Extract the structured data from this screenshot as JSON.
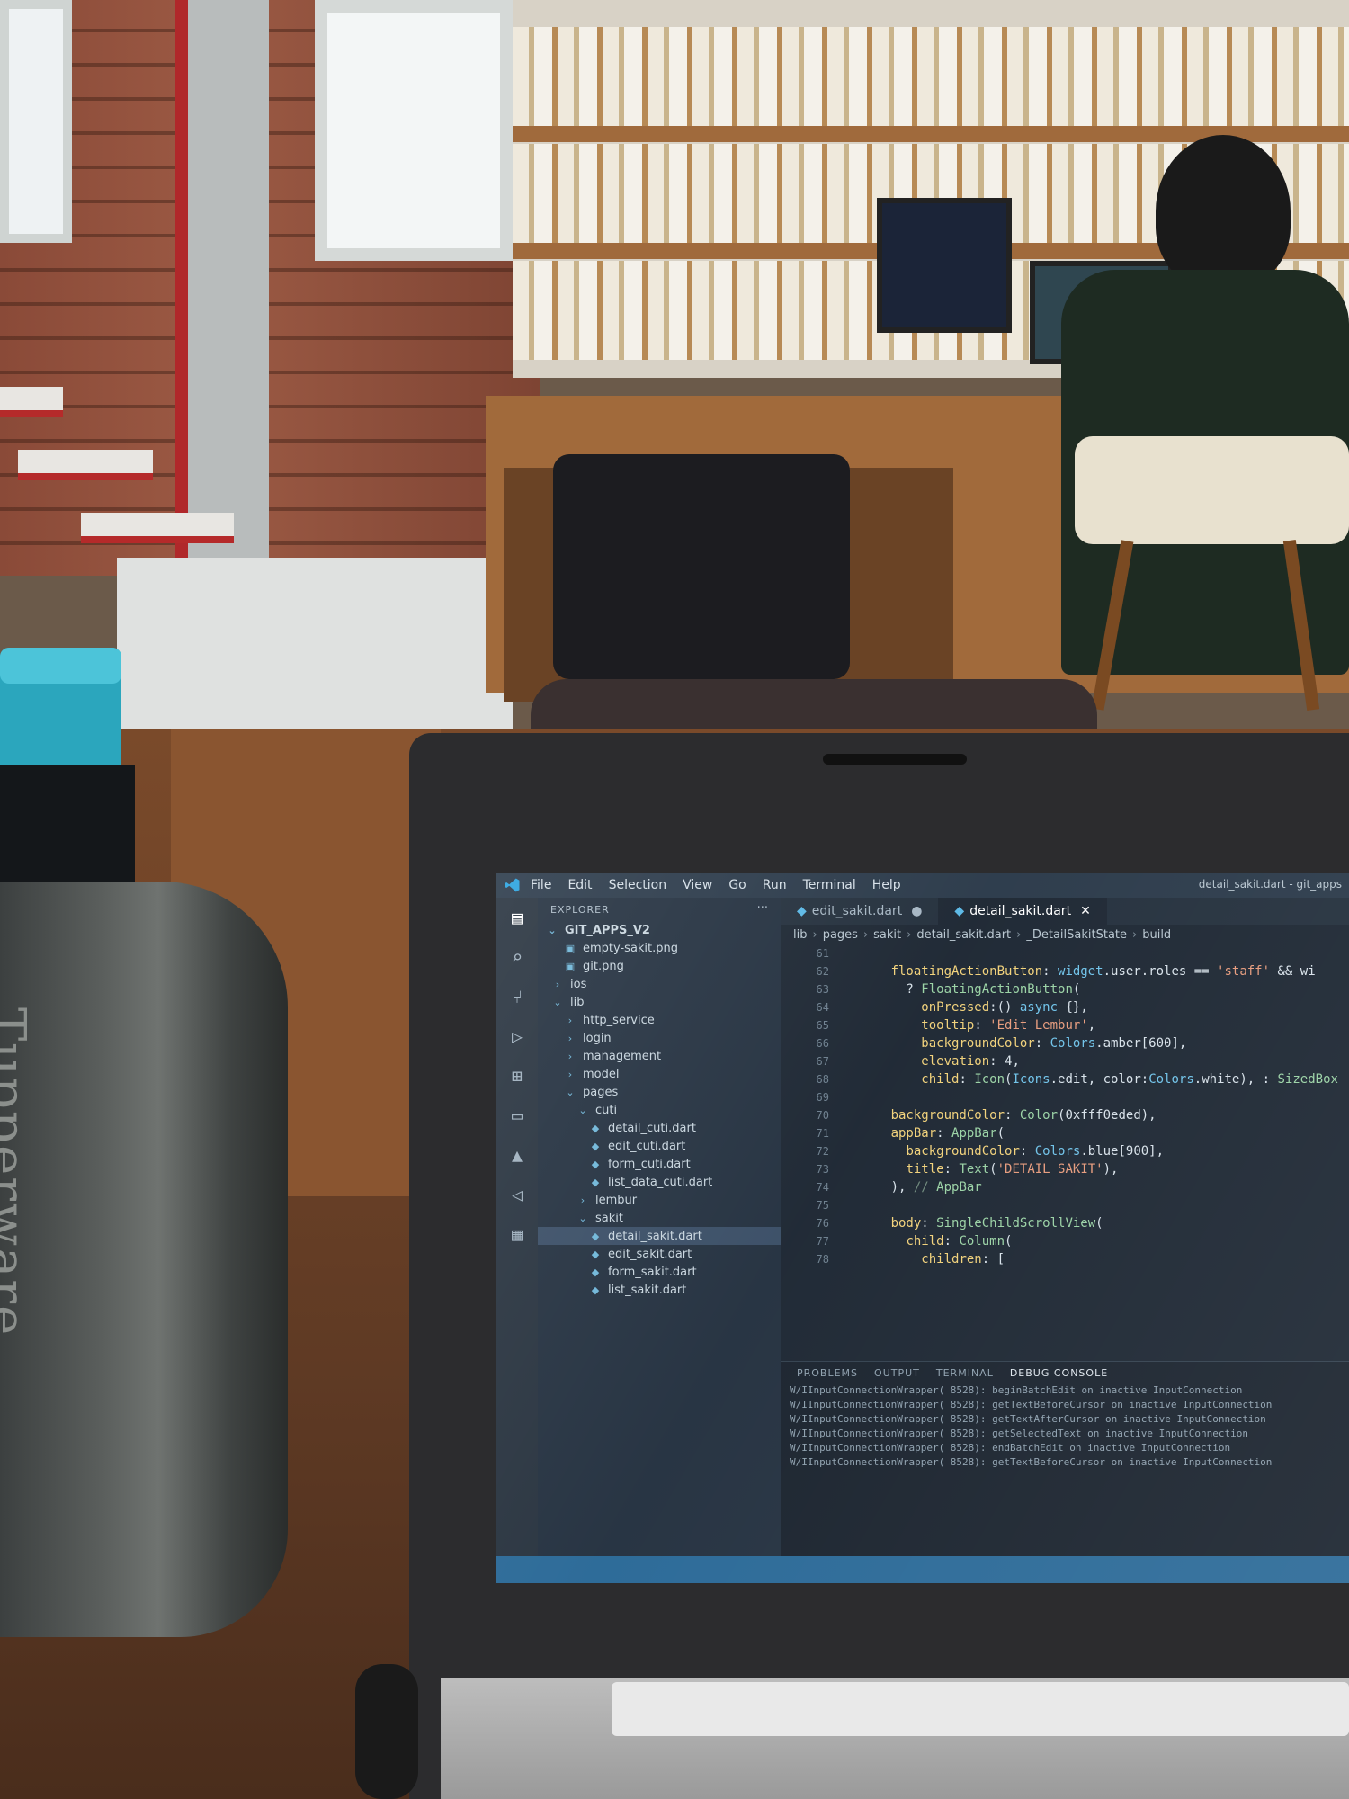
{
  "colors": {
    "accent": "#2f7fb8",
    "dart": "#5ab8e6",
    "keyword": "#f2d27a"
  },
  "photo": {
    "bottle_brand": "Tupperware"
  },
  "window": {
    "title": "detail_sakit.dart - git_apps",
    "menu": [
      "File",
      "Edit",
      "Selection",
      "View",
      "Go",
      "Run",
      "Terminal",
      "Help"
    ]
  },
  "activity_icons": [
    "explorer-icon",
    "search-icon",
    "source-control-icon",
    "debug-icon",
    "extensions-icon",
    "remote-icon",
    "testing-icon",
    "share-icon",
    "calendar-icon"
  ],
  "sidebar": {
    "title": "EXPLORER",
    "more": "···",
    "root": "GIT_APPS_V2",
    "items": [
      {
        "label": "empty-sakit.png",
        "indent": 1,
        "icon": "▣"
      },
      {
        "label": "git.png",
        "indent": 1,
        "icon": "▣"
      },
      {
        "label": "ios",
        "indent": 0,
        "icon": "›"
      },
      {
        "label": "lib",
        "indent": 0,
        "icon": "⌄"
      },
      {
        "label": "http_service",
        "indent": 1,
        "icon": "›"
      },
      {
        "label": "login",
        "indent": 1,
        "icon": "›"
      },
      {
        "label": "management",
        "indent": 1,
        "icon": "›"
      },
      {
        "label": "model",
        "indent": 1,
        "icon": "›"
      },
      {
        "label": "pages",
        "indent": 1,
        "icon": "⌄"
      },
      {
        "label": "cuti",
        "indent": 2,
        "icon": "⌄"
      },
      {
        "label": "detail_cuti.dart",
        "indent": 3,
        "icon": "◆"
      },
      {
        "label": "edit_cuti.dart",
        "indent": 3,
        "icon": "◆"
      },
      {
        "label": "form_cuti.dart",
        "indent": 3,
        "icon": "◆"
      },
      {
        "label": "list_data_cuti.dart",
        "indent": 3,
        "icon": "◆"
      },
      {
        "label": "lembur",
        "indent": 2,
        "icon": "›"
      },
      {
        "label": "sakit",
        "indent": 2,
        "icon": "⌄"
      },
      {
        "label": "detail_sakit.dart",
        "indent": 3,
        "icon": "◆",
        "active": true
      },
      {
        "label": "edit_sakit.dart",
        "indent": 3,
        "icon": "◆"
      },
      {
        "label": "form_sakit.dart",
        "indent": 3,
        "icon": "◆"
      },
      {
        "label": "list_sakit.dart",
        "indent": 3,
        "icon": "◆"
      }
    ]
  },
  "tabs": [
    {
      "label": "edit_sakit.dart",
      "active": false,
      "close": "●"
    },
    {
      "label": "detail_sakit.dart",
      "active": true,
      "close": "✕"
    }
  ],
  "breadcrumb": [
    "lib",
    "pages",
    "sakit",
    "detail_sakit.dart",
    "_DetailSakitState",
    "build"
  ],
  "code": {
    "line_numbers": [
      61,
      62,
      63,
      64,
      65,
      66,
      67,
      68,
      69,
      70,
      71,
      72,
      73,
      74,
      75,
      76,
      77,
      78
    ],
    "lines": [
      "",
      "      floatingActionButton: widget.user.roles == 'staff' && wi",
      "        ? FloatingActionButton(",
      "          onPressed:() async {},",
      "          tooltip: 'Edit Lembur', ",
      "          backgroundColor: Colors.amber[600],",
      "          elevation: 4,",
      "          child: Icon(Icons.edit, color:Colors.white), : SizedBox",
      "",
      "      backgroundColor: Color(0xfff0eded),",
      "      appBar: AppBar(",
      "        backgroundColor: Colors.blue[900],",
      "        title: Text('DETAIL SAKIT'),",
      "      ), // AppBar",
      "",
      "      body: SingleChildScrollView(",
      "        child: Column(",
      "          children: ["
    ]
  },
  "panel": {
    "tabs": [
      "PROBLEMS",
      "OUTPUT",
      "TERMINAL",
      "DEBUG CONSOLE"
    ],
    "active_tab": "DEBUG CONSOLE",
    "logs": [
      "W/IInputConnectionWrapper( 8528): beginBatchEdit on inactive InputConnection",
      "W/IInputConnectionWrapper( 8528): getTextBeforeCursor on inactive InputConnection",
      "W/IInputConnectionWrapper( 8528): getTextAfterCursor on inactive InputConnection",
      "W/IInputConnectionWrapper( 8528): getSelectedText on inactive InputConnection",
      "W/IInputConnectionWrapper( 8528): endBatchEdit on inactive InputConnection",
      "W/IInputConnectionWrapper( 8528): getTextBeforeCursor on inactive InputConnection"
    ]
  }
}
